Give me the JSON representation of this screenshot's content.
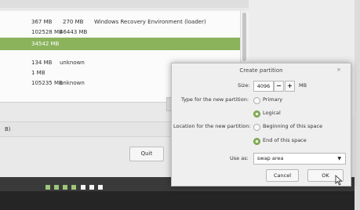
{
  "partition_list": {
    "rows": [
      {
        "size": "367 MB",
        "used": "270 MB",
        "system": "Windows Recovery Environment (loader)"
      },
      {
        "size": "102528 MB",
        "used": "46443 MB",
        "system": ""
      },
      {
        "size": "34542 MB",
        "used": "",
        "system": ""
      },
      {
        "size": "134 MB",
        "used": "unknown",
        "system": ""
      },
      {
        "size": "1 MB",
        "used": "",
        "system": ""
      },
      {
        "size": "105235 MB",
        "used": "unknown",
        "system": ""
      }
    ]
  },
  "strip_text": "B)",
  "quit_label": "Quit",
  "progress_dots": {
    "green": 4,
    "white": 3,
    "colors": {
      "green": "#9cc77b",
      "white": "#f4f4f4"
    }
  },
  "dialog": {
    "title": "Create partition",
    "size_label": "Size:",
    "size_value": "4096",
    "minus": "−",
    "plus": "+",
    "unit": "MB",
    "type_label": "Type for the new partition:",
    "type_primary": "Primary",
    "type_logical": "Logical",
    "location_label": "Location for the new partition:",
    "loc_beginning": "Beginning of this space",
    "loc_end": "End of this space",
    "use_as_label": "Use as:",
    "use_as_value": "swap area",
    "cancel": "Cancel",
    "ok": "OK",
    "close": "×"
  },
  "accent_color": "#8ab35c"
}
